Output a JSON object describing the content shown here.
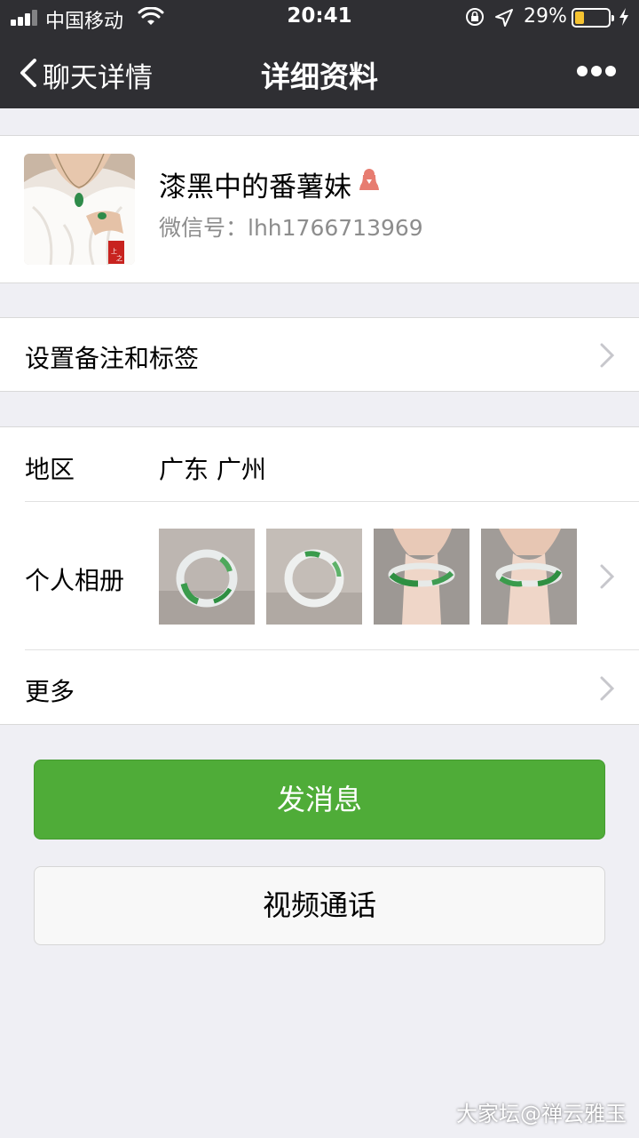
{
  "status_bar": {
    "carrier": "中国移动",
    "time": "20:41",
    "battery_percent": "29%",
    "battery_level": 0.29
  },
  "nav": {
    "back_label": "聊天详情",
    "title": "详细资料"
  },
  "profile": {
    "nickname": "漆黑中的番薯妹",
    "wechat_id": "微信号：lhh1766713969",
    "gender_icon": "female-icon",
    "gender_color": "#e77c70"
  },
  "remark_row": {
    "label": "设置备注和标签"
  },
  "region": {
    "label": "地区",
    "value": "广东 广州"
  },
  "album": {
    "label": "个人相册",
    "photo_count": 4
  },
  "more_row": {
    "label": "更多"
  },
  "buttons": {
    "send_message": "发消息",
    "video_call": "视频通话"
  },
  "watermark": "大家坛@禅云雅玉",
  "colors": {
    "header_bg": "#2f2f33",
    "page_bg": "#efeff4",
    "primary_green": "#4fac38"
  }
}
